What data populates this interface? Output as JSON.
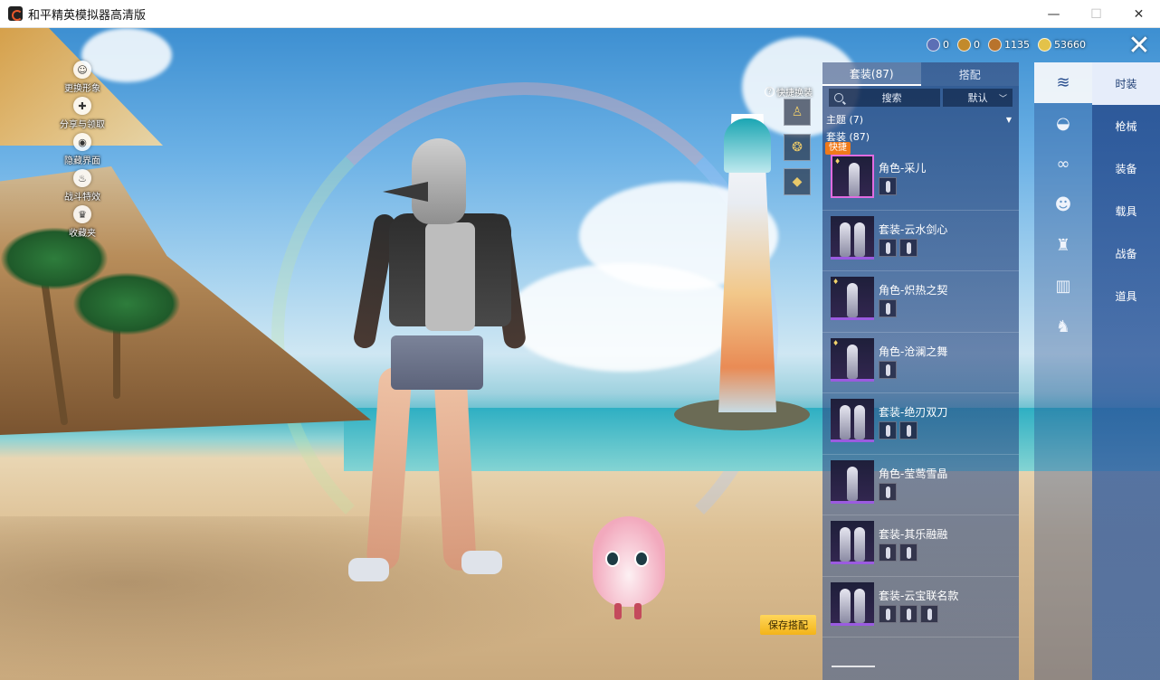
{
  "window": {
    "title": "和平精英模拟器高清版",
    "min_glyph": "—",
    "max_glyph": "☐",
    "close_glyph": "✕"
  },
  "side_actions": [
    {
      "label": "更换形象",
      "icon": "person-icon",
      "glyph": "☺"
    },
    {
      "label": "分享与领取",
      "icon": "share-icon",
      "glyph": "✚"
    },
    {
      "label": "隐藏界面",
      "icon": "eye-icon",
      "glyph": "◉"
    },
    {
      "label": "战斗特效",
      "icon": "flame-icon",
      "glyph": "♨"
    },
    {
      "label": "收藏夹",
      "icon": "trophy-icon",
      "glyph": "♛"
    }
  ],
  "currencies": [
    {
      "value": "0",
      "icon": "coupon-icon",
      "color": "#5c6fb5"
    },
    {
      "value": "0",
      "icon": "token-icon",
      "color": "#c28a2b"
    },
    {
      "value": "1135",
      "icon": "medal-icon",
      "color": "#b8732c"
    },
    {
      "value": "53660",
      "icon": "coin-icon",
      "color": "#e3c24a"
    }
  ],
  "close_button": "✕",
  "quick_swap": {
    "label": "快捷换装",
    "help_glyph": "?",
    "slots": [
      {
        "icon": "outfit-slot-icon",
        "glyph": "♙"
      },
      {
        "icon": "emblem-slot-icon",
        "glyph": "❂"
      },
      {
        "icon": "diamond-slot-icon",
        "glyph": "◆"
      }
    ]
  },
  "panel": {
    "tabs": [
      {
        "label": "套装(87)",
        "active": true
      },
      {
        "label": "搭配",
        "active": false
      }
    ],
    "search_label": "搜索",
    "sort_label": "默认",
    "sort_chevron": "﹀",
    "theme_group": "主题 (7)",
    "theme_toggle": "▼",
    "suit_group": "套装 (87)",
    "quick_tag": "快捷",
    "own_mark": "♦",
    "items": [
      {
        "name": "角色-采儿",
        "subs": 1,
        "selected": true,
        "owned": true
      },
      {
        "name": "套装-云水剑心",
        "subs": 2,
        "selected": false,
        "owned": false
      },
      {
        "name": "角色-炽热之契",
        "subs": 1,
        "selected": false,
        "owned": true
      },
      {
        "name": "角色-沧澜之舞",
        "subs": 1,
        "selected": false,
        "owned": true
      },
      {
        "name": "套装-绝刃双刀",
        "subs": 2,
        "selected": false,
        "owned": false
      },
      {
        "name": "角色-莹莺雪晶",
        "subs": 1,
        "selected": false,
        "owned": false
      },
      {
        "name": "套装-其乐融融",
        "subs": 2,
        "selected": false,
        "owned": false
      },
      {
        "name": "套装-云宝联名款",
        "subs": 3,
        "selected": false,
        "owned": false
      }
    ]
  },
  "save_button": "保存搭配",
  "category_icons": [
    {
      "icon": "outfit-icon",
      "glyph": "≋",
      "active": true
    },
    {
      "icon": "cap-icon",
      "glyph": "◒",
      "active": false
    },
    {
      "icon": "goggles-icon",
      "glyph": "∞",
      "active": false
    },
    {
      "icon": "mask-icon",
      "glyph": "☻",
      "active": false
    },
    {
      "icon": "jacket-icon",
      "glyph": "♜",
      "active": false
    },
    {
      "icon": "pants-icon",
      "glyph": "▥",
      "active": false
    },
    {
      "icon": "shoes-icon",
      "glyph": "♞",
      "active": false
    }
  ],
  "categories": [
    {
      "label": "时装",
      "active": true
    },
    {
      "label": "枪械",
      "active": false
    },
    {
      "label": "装备",
      "active": false
    },
    {
      "label": "载具",
      "active": false
    },
    {
      "label": "战备",
      "active": false
    },
    {
      "label": "道具",
      "active": false
    }
  ]
}
